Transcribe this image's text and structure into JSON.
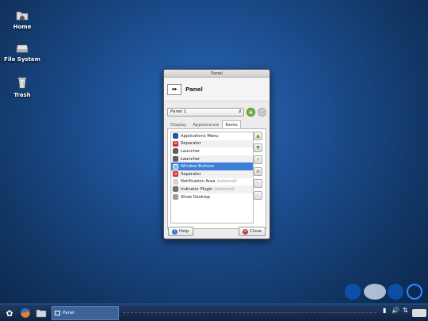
{
  "desktop": {
    "icons": [
      {
        "label": "Home",
        "icon": "home-folder-icon"
      },
      {
        "label": "File System",
        "icon": "drive-icon"
      },
      {
        "label": "Trash",
        "icon": "trash-icon"
      }
    ]
  },
  "window": {
    "title": "Panel",
    "header_title": "Panel",
    "panel_select": "Panel 1",
    "tabs": [
      "Display",
      "Appearance",
      "Items"
    ],
    "active_tab": "Items",
    "items": [
      {
        "label": "Applications Menu",
        "suffix": "",
        "icon": "applications-menu-icon",
        "selected": false
      },
      {
        "label": "Separator",
        "suffix": "",
        "icon": "separator-icon",
        "selected": false
      },
      {
        "label": "Launcher",
        "suffix": "",
        "icon": "launcher-icon",
        "selected": false
      },
      {
        "label": "Launcher",
        "suffix": "",
        "icon": "launcher-icon",
        "selected": false
      },
      {
        "label": "Window Buttons",
        "suffix": "",
        "icon": "window-buttons-icon",
        "selected": true
      },
      {
        "label": "Separator",
        "suffix": "",
        "icon": "separator-icon",
        "selected": false
      },
      {
        "label": "Notification Area",
        "suffix": "(external)",
        "icon": "notification-area-icon",
        "selected": false
      },
      {
        "label": "Indicator Plugin",
        "suffix": "(external)",
        "icon": "indicator-plugin-icon",
        "selected": false
      },
      {
        "label": "Show Desktop",
        "suffix": "",
        "icon": "show-desktop-icon",
        "selected": false
      }
    ],
    "help_label": "Help",
    "close_label": "Close"
  },
  "taskbar": {
    "task_label": "Panel"
  },
  "colors": {
    "accent": "#3d7fd8",
    "workspace": "#0c4fa8",
    "separator_line": "#c62f4a"
  }
}
